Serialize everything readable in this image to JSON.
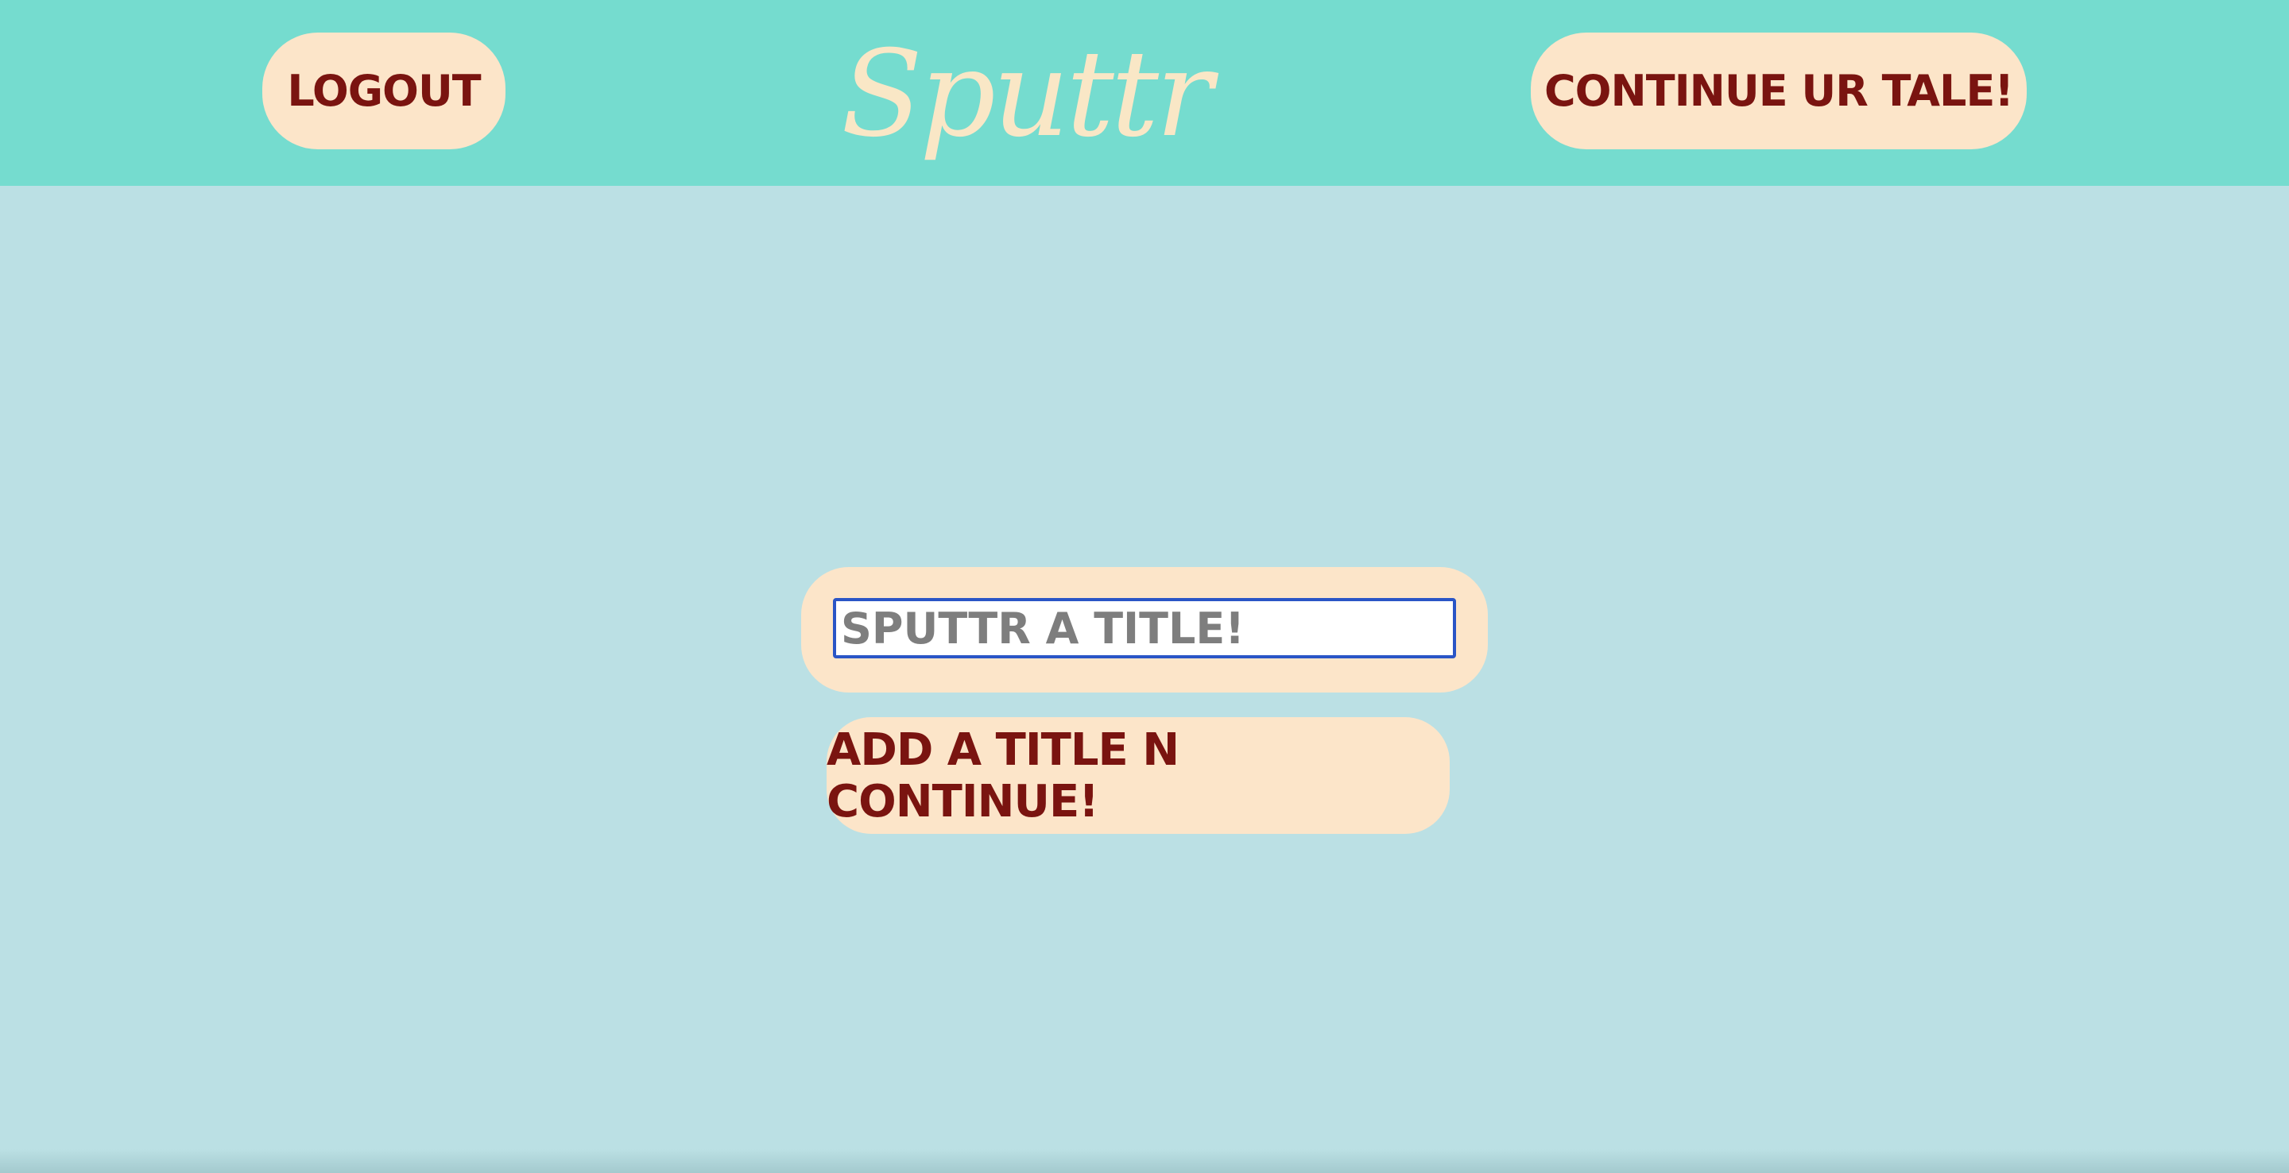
{
  "header": {
    "logout_label": "LOGOUT",
    "logo_text": "Sputtr",
    "continue_tale_label": "CONTINUE UR TALE!"
  },
  "main": {
    "title_input": {
      "placeholder": "SPUTTR A TITLE!",
      "value": ""
    },
    "add_title_label": "ADD A TITLE N CONTINUE!"
  },
  "colors": {
    "header_bg": "#75dccf",
    "page_bg": "#bbe0e4",
    "button_bg": "#fce5c9",
    "button_text": "#7a1410",
    "logo": "#f9e7c6",
    "input_focus_border": "#2a55c6"
  }
}
